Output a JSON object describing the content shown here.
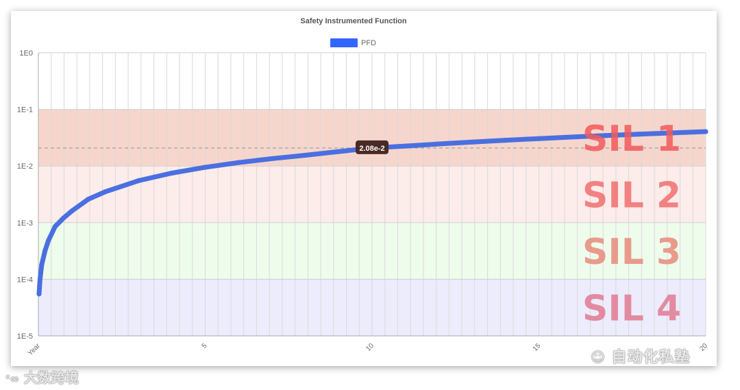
{
  "chart_data": {
    "type": "line",
    "title": "Safety Instrumented Function",
    "legend": {
      "label": "PFD",
      "position": "top",
      "color": "#3366ff"
    },
    "xlim": [
      0,
      20
    ],
    "x_tick_first_label": "Year",
    "x_ticks": [
      5,
      10,
      15,
      20
    ],
    "y_scale": "log",
    "ylim": [
      1e-05,
      1
    ],
    "y_ticks": [
      "1E0",
      "1E-1",
      "1E-2",
      "1E-3",
      "1E-4",
      "1E-5"
    ],
    "grid": true,
    "series": [
      {
        "name": "PFD",
        "color": "#4a6fe0",
        "x": [
          0.02,
          0.05,
          0.1,
          0.2,
          0.3,
          0.5,
          0.75,
          1,
          1.5,
          2,
          3,
          4,
          5,
          6,
          7,
          8,
          9,
          10,
          11,
          12,
          13,
          14,
          15,
          16,
          17,
          18,
          19,
          20
        ],
        "y": [
          5.5e-05,
          0.0001,
          0.00018,
          0.00032,
          0.00048,
          0.00085,
          0.0012,
          0.0016,
          0.0026,
          0.0035,
          0.0055,
          0.0075,
          0.0095,
          0.0115,
          0.0135,
          0.0155,
          0.018,
          0.0208,
          0.0225,
          0.0245,
          0.0265,
          0.0285,
          0.0305,
          0.0325,
          0.0345,
          0.0365,
          0.0385,
          0.0405
        ]
      }
    ],
    "bands": [
      {
        "label": "SIL 1",
        "from": 0.01,
        "to": 0.1,
        "fill": "#f6d6cc",
        "text_color": "#f05a5a"
      },
      {
        "label": "SIL 2",
        "from": 0.001,
        "to": 0.01,
        "fill": "#fcecea",
        "text_color": "#f07070"
      },
      {
        "label": "SIL 3",
        "from": 0.0001,
        "to": 0.001,
        "fill": "#eefcec",
        "text_color": "#e88a7a"
      },
      {
        "label": "SIL 4",
        "from": 1e-05,
        "to": 0.0001,
        "fill": "#ececfd",
        "text_color": "#e07a90"
      }
    ],
    "reference_line": {
      "value": 0.0208
    },
    "annotation": {
      "text": "2.08e-2",
      "x": 10,
      "y": 0.0208
    }
  },
  "watermarks": {
    "right": "自动化私塾",
    "left": "大数跨境"
  }
}
